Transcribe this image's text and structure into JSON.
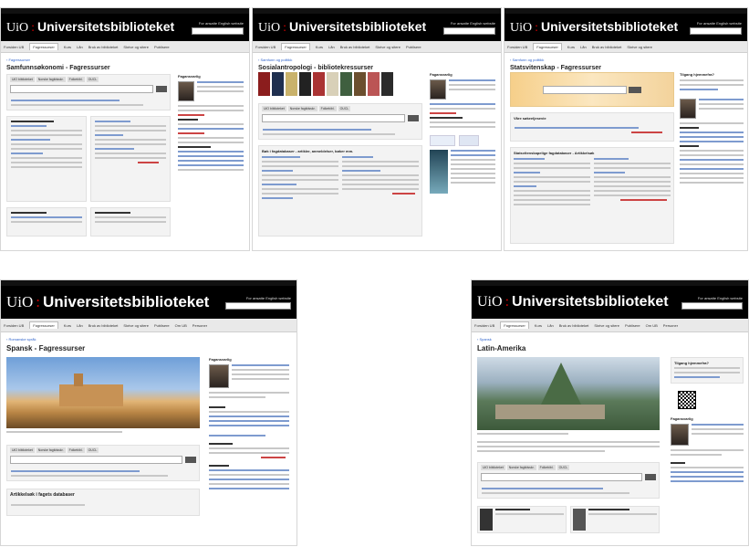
{
  "shared": {
    "logo_uio": "UiO",
    "logo_sep": ":",
    "logo_name": "Universitetsbiblioteket",
    "header_links": "For ansatte  English website",
    "nav": [
      "Forsiden UB",
      "Fagressurser",
      "Kurs",
      "Lån",
      "Bruk av biblioteket",
      "Skrive og sitere",
      "Publisere",
      "Om UB",
      "Personer"
    ]
  },
  "shots": [
    {
      "breadcrumb": "‹ Fagressurser",
      "title": "Samfunnsøkonomi - Fagressurser",
      "side_heading": "Fagansvarlig",
      "tabs": [
        "UiO biblioteket",
        "Norske fagtidsskr.",
        "Folkebibl.",
        "OUCL"
      ]
    },
    {
      "breadcrumb": "‹ Samfunn og politikk",
      "title": "Sosialantropologi - bibliotekressurser",
      "side_heading": "Fagansvarlig",
      "section": "Bøk i fagdatabaser - artikler, anmeldelser, bøker mm.",
      "tabs": [
        "UiO biblioteket",
        "Norske fagtidsskr.",
        "Folkebibl.",
        "OUCL"
      ]
    },
    {
      "breadcrumb": "‹ Samfunn og politikk",
      "title": "Statsvitenskap - Fagressurser",
      "side_heading": "Tilgang hjemmefra?",
      "section": "Statsvitenskapelige fagdatabaser - Artikkelsøk",
      "section2": "Våre søkeeljesevie"
    },
    {
      "breadcrumb": "‹ Romanske språk",
      "title": "Spansk - Fagressurser",
      "side_heading": "Fagansvarlig",
      "section": "Artikkelsøk i fagets databaser",
      "tabs": [
        "UiO biblioteket",
        "Norske fagtidsskr.",
        "Folkebibl.",
        "OUCL"
      ]
    },
    {
      "breadcrumb": "‹ Spansk",
      "title": "Latin-Amerika",
      "side_heading": "Tilgang hjemmefra?",
      "side_heading2": "Fagansvarlig",
      "tabs": [
        "UiO biblioteket",
        "Norske fagtidsskr.",
        "Folkebibl.",
        "OUCL"
      ]
    }
  ],
  "colors": {
    "header": "#000000",
    "accent": "#cc0000",
    "link": "#3366cc"
  }
}
